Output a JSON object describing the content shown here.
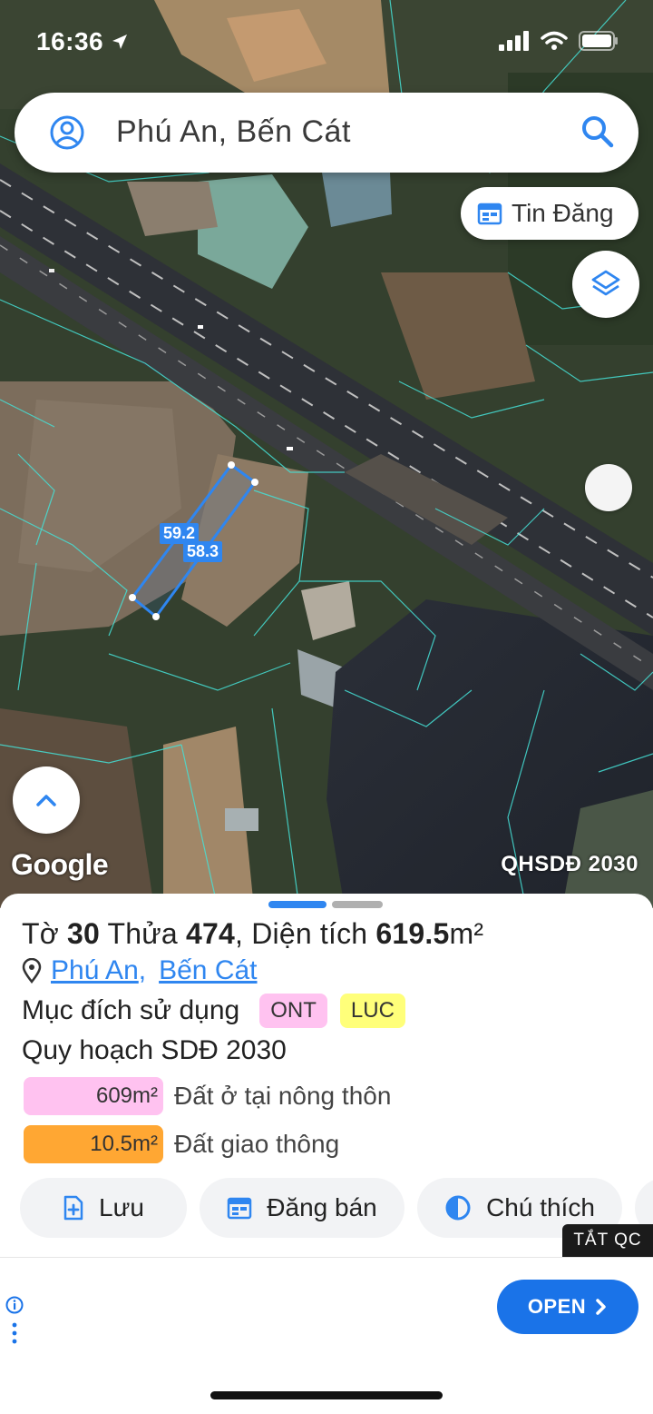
{
  "status_bar": {
    "time": "16:36"
  },
  "search": {
    "text": "Phú An, Bến Cát"
  },
  "map": {
    "tin_dang_label": "Tin Đăng",
    "google_label": "Google",
    "plan_label": "QHSDĐ 2030",
    "dimension_labels": [
      "59.2",
      "58.3"
    ]
  },
  "parcel": {
    "to_label": "Tờ",
    "to_value": "30",
    "thua_label": "Thửa",
    "thua_value": "474",
    "dien_tich_label": "Diện tích",
    "dien_tich_value": "619.5",
    "unit": "m²",
    "ward": "Phú An",
    "district": "Bến Cát",
    "usage_label": "Mục đích sử dụng",
    "usage_tags": [
      "ONT",
      "LUC"
    ],
    "plan_title": "Quy hoạch SDĐ 2030",
    "plan_items": [
      {
        "area": "609m²",
        "desc": "Đất ở tại nông thôn",
        "color": "#ffc2f0"
      },
      {
        "area": "10.5m²",
        "desc": "Đất giao thông",
        "color": "#ffa733"
      }
    ]
  },
  "actions": {
    "save": "Lưu",
    "post_sale": "Đăng bán",
    "legend": "Chú thích"
  },
  "ad": {
    "hide_label": "TẮT QC",
    "open_label": "OPEN"
  },
  "colors": {
    "accent": "#2f86f0",
    "open_button": "#1a73e8"
  }
}
